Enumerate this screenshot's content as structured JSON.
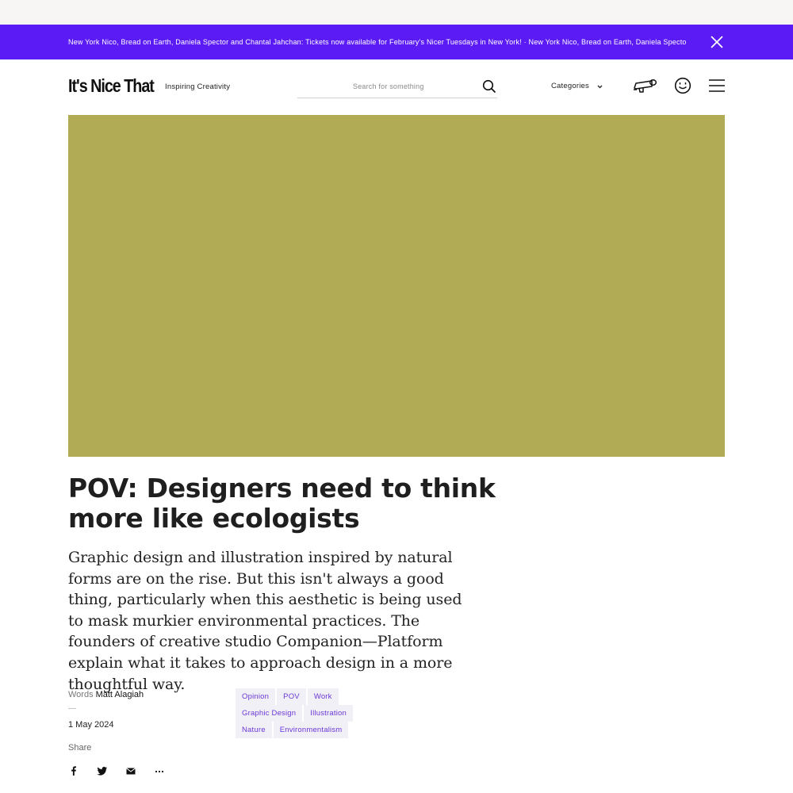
{
  "banner": {
    "text": "New York Nico, Bread on Earth, Daniela Spector and Chantal Jahchan: Tickets now available for February's Nicer Tuesdays in New York! · New York Nico, Bread on Earth, Daniela Spector and Chantal Jahchan: Tickets now available for February's Nicer Tuesdays in New York!",
    "close_icon": "close-icon",
    "background": "#5b1bf5"
  },
  "header": {
    "logo": "It's Nice That",
    "tagline": "Inspiring Creativity",
    "search_placeholder": "Search for something",
    "search_value": "",
    "categories_label": "Categories",
    "icons": [
      "search-icon",
      "chevron-down-icon",
      "megaphone-icon",
      "smiley-icon",
      "menu-icon"
    ]
  },
  "hero": {
    "color": "#b2ab55"
  },
  "article": {
    "title": "POV: Designers need to think more like ecologists",
    "standfirst": "Graphic design and illustration inspired by natural forms are on the rise. But this isn't always a good thing, particularly when this aesthetic is being used to mask murkier environmental practices. The founders of creative studio Companion—Platform explain what it takes to approach design in a more thoughtful way.",
    "words_label": "Words",
    "author": "Matt Alagiah",
    "dash": "—",
    "date": "1 May 2024",
    "share_label": "Share",
    "share_icons": [
      "facebook-icon",
      "twitter-icon",
      "email-icon",
      "more-icon"
    ]
  },
  "tags": {
    "row1": [
      "Opinion",
      "POV",
      "Work"
    ],
    "row2": [
      "Graphic Design",
      "Illustration"
    ],
    "row3": [
      "Nature",
      "Environmentalism"
    ],
    "accent": "#6a38d6"
  }
}
